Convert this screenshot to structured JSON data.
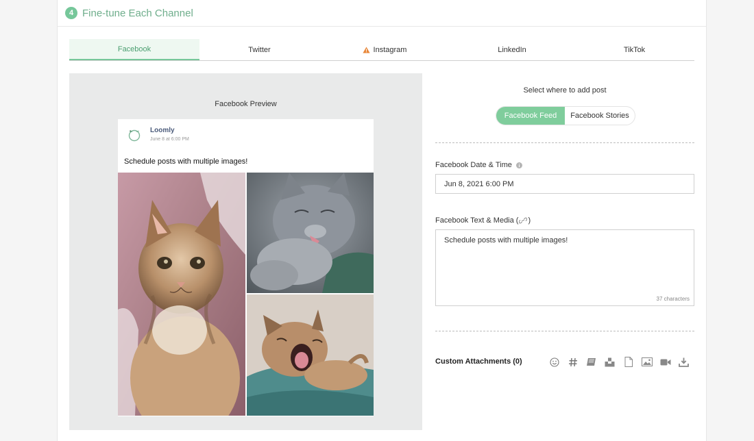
{
  "step": {
    "number": "4",
    "title": "Fine-tune Each Channel"
  },
  "tabs": [
    {
      "label": "Facebook",
      "active": true,
      "warning": false
    },
    {
      "label": "Twitter",
      "active": false,
      "warning": false
    },
    {
      "label": "Instagram",
      "active": false,
      "warning": true
    },
    {
      "label": "LinkedIn",
      "active": false,
      "warning": false
    },
    {
      "label": "TikTok",
      "active": false,
      "warning": false
    }
  ],
  "preview": {
    "title": "Facebook Preview",
    "author": "Loomly",
    "date": "June 8 at 6:00 PM",
    "text": "Schedule posts with multiple images!",
    "images": [
      "kitten-portrait",
      "gray-cat-licking",
      "kitten-yawning"
    ]
  },
  "placement": {
    "label": "Select where to add post",
    "options": [
      "Facebook Feed",
      "Facebook Stories"
    ],
    "selected": "Facebook Feed"
  },
  "date_field": {
    "label": "Facebook Date & Time",
    "value": "Jun 8, 2021 6:00 PM"
  },
  "text_field": {
    "label": "Facebook Text & Media (",
    "label_end": ")",
    "value": "Schedule posts with multiple images!",
    "char_count": "37 characters"
  },
  "attachments": {
    "label": "Custom Attachments (0)",
    "icons": [
      "emoji-icon",
      "hashtag-icon",
      "library-icon",
      "inbox-icon",
      "document-icon",
      "image-icon",
      "video-icon",
      "download-icon"
    ]
  },
  "colors": {
    "accent": "#76c79a",
    "accent_text": "#6fae8c",
    "warning": "#e8873a"
  }
}
